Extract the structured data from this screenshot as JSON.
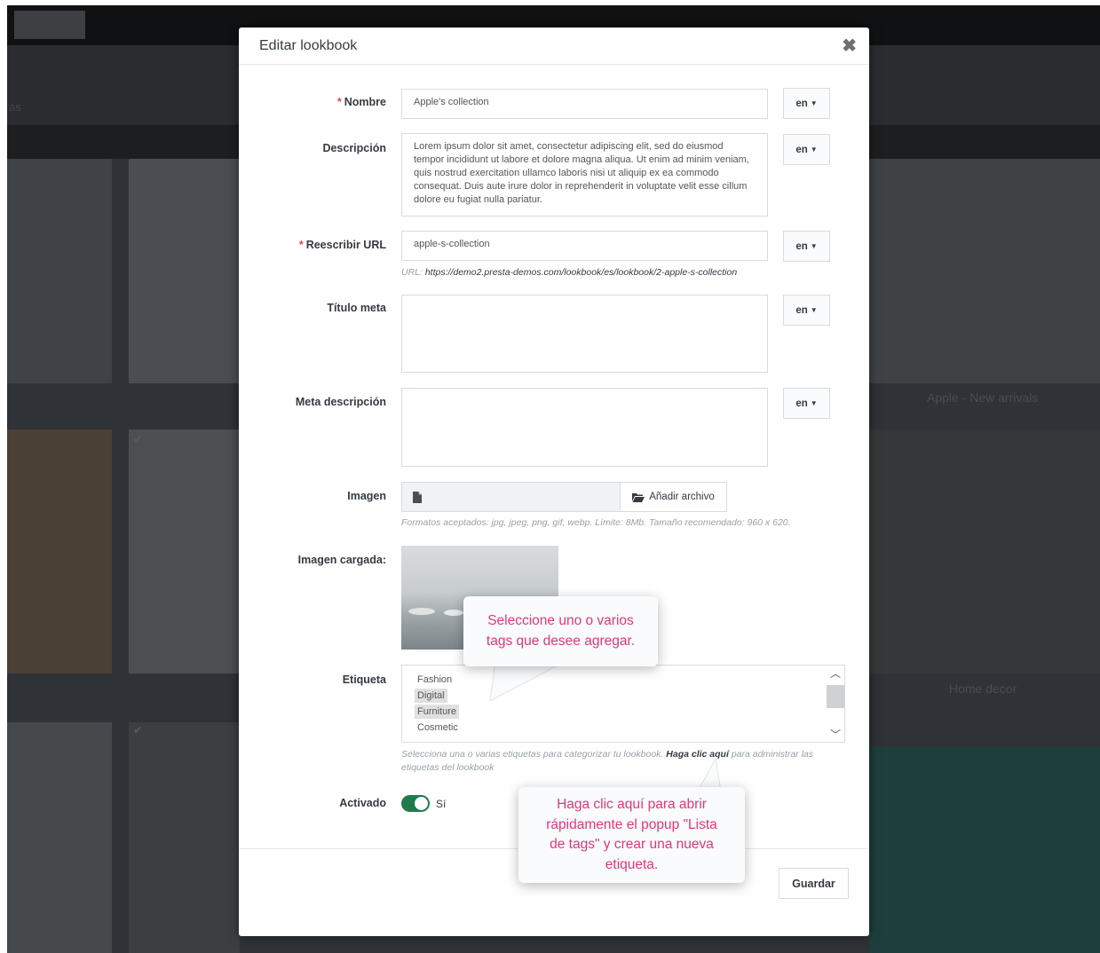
{
  "background": {
    "tile_captions": [
      "Apple - New arrivals",
      "Home decor"
    ],
    "left_fragment": "as"
  },
  "modal": {
    "title": "Editar lookbook",
    "close_icon": "close-icon"
  },
  "form": {
    "required_mark": "*",
    "lang_code": "en",
    "nombre": {
      "label": "Nombre",
      "value": "Apple's collection"
    },
    "descripcion": {
      "label": "Descripción",
      "value": "Lorem ipsum dolor sit amet, consectetur adipiscing elit, sed do eiusmod tempor incididunt ut labore et dolore magna aliqua. Ut enim ad minim veniam, quis nostrud exercitation ullamco laboris nisi ut aliquip ex ea commodo consequat. Duis aute irure dolor in reprehenderit in voluptate velit esse cillum dolore eu fugiat nulla pariatur."
    },
    "url": {
      "label": "Reescribir URL",
      "value": "apple-s-collection",
      "help_prefix": "URL: ",
      "help_link": "https://demo2.presta-demos.com/lookbook/es/lookbook/2-apple-s-collection"
    },
    "titulo_meta": {
      "label": "Título meta",
      "value": ""
    },
    "meta_descripcion": {
      "label": "Meta descripción",
      "value": ""
    },
    "imagen": {
      "label": "Imagen",
      "add_button": "Añadir archivo",
      "help": "Formatos aceptados: jpg, jpeg, png, gif, webp. Límite: 8Mb. Tamaño recomendado: 960 x 620."
    },
    "imagen_cargada": {
      "label": "Imagen cargada:"
    },
    "etiqueta": {
      "label": "Etiqueta",
      "options": [
        "Fashion",
        "Digital",
        "Furniture",
        "Cosmetic"
      ],
      "selected": [
        "Digital",
        "Furniture"
      ],
      "help_before": "Selecciona una o varias etiquetas para categorizar tu lookbook.",
      "help_link": "Haga clic aquí",
      "help_after": "para administrar las",
      "help_line2": "etiquetas del lookbook"
    },
    "activado": {
      "label": "Activado",
      "value_text": "Sí",
      "on": true
    }
  },
  "footer": {
    "save_label": "Guardar"
  },
  "callouts": {
    "tags": [
      "Seleccione uno o varios",
      "tags que desee agregar."
    ],
    "popup": [
      "Haga clic aquí para abrir",
      "rápidamente el popup \"Lista",
      "de tags\" y crear una nueva",
      "etiqueta."
    ]
  },
  "colors": {
    "accent_pink": "#e0377a",
    "toggle_green": "#1f7a4e",
    "required_red": "#e5484d"
  }
}
